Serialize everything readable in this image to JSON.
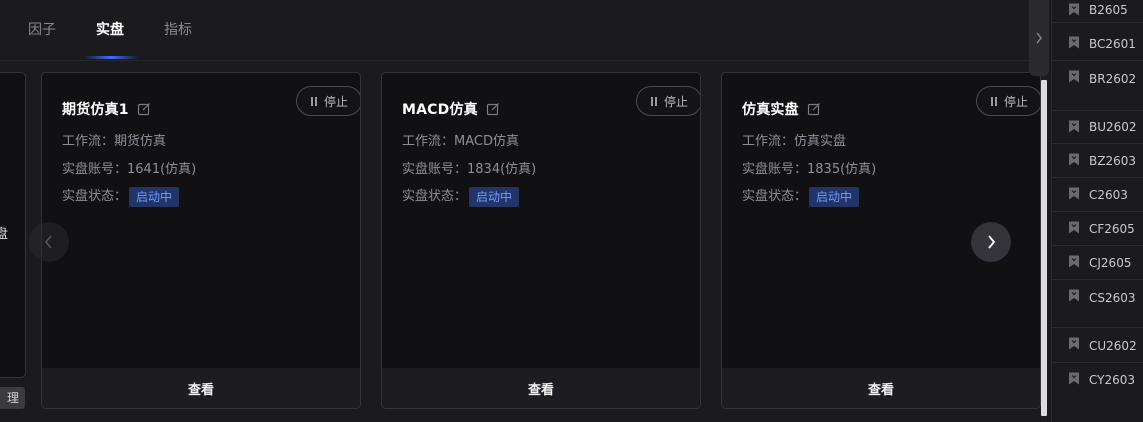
{
  "tabs": [
    {
      "label": "因子"
    },
    {
      "label": "实盘"
    },
    {
      "label": "指标"
    }
  ],
  "prev_card": {
    "partial_label": "盘"
  },
  "manage_button": {
    "label": "理"
  },
  "cards": [
    {
      "title": "期货仿真1",
      "stop_label": "停止",
      "workflow_label": "工作流：",
      "workflow_value": "期货仿真",
      "account_label": "实盘账号：",
      "account_value": "1641(仿真)",
      "status_label": "实盘状态：",
      "status_value": "启动中",
      "view_label": "查看"
    },
    {
      "title": "MACD仿真",
      "stop_label": "停止",
      "workflow_label": "工作流：",
      "workflow_value": "MACD仿真",
      "account_label": "实盘账号：",
      "account_value": "1834(仿真)",
      "status_label": "实盘状态：",
      "status_value": "启动中",
      "view_label": "查看"
    },
    {
      "title": "仿真实盘",
      "stop_label": "停止",
      "workflow_label": "工作流：",
      "workflow_value": "仿真实盘",
      "account_label": "实盘账号：",
      "account_value": "1835(仿真)",
      "status_label": "实盘状态：",
      "status_value": "启动中",
      "view_label": "查看"
    }
  ],
  "contracts": [
    {
      "label": "B2605"
    },
    {
      "label": "BC2601"
    },
    {
      "label": "BR2602"
    },
    {
      "label": "BU2602"
    },
    {
      "label": "BZ2603"
    },
    {
      "label": "C2603"
    },
    {
      "label": "CF2605"
    },
    {
      "label": "CJ2605"
    },
    {
      "label": "CS2603"
    },
    {
      "label": "CU2602"
    },
    {
      "label": "CY2603"
    }
  ],
  "colors": {
    "accent": "#3f6dff",
    "status_badge_bg": "#223566",
    "status_badge_text": "#6f9bff"
  }
}
